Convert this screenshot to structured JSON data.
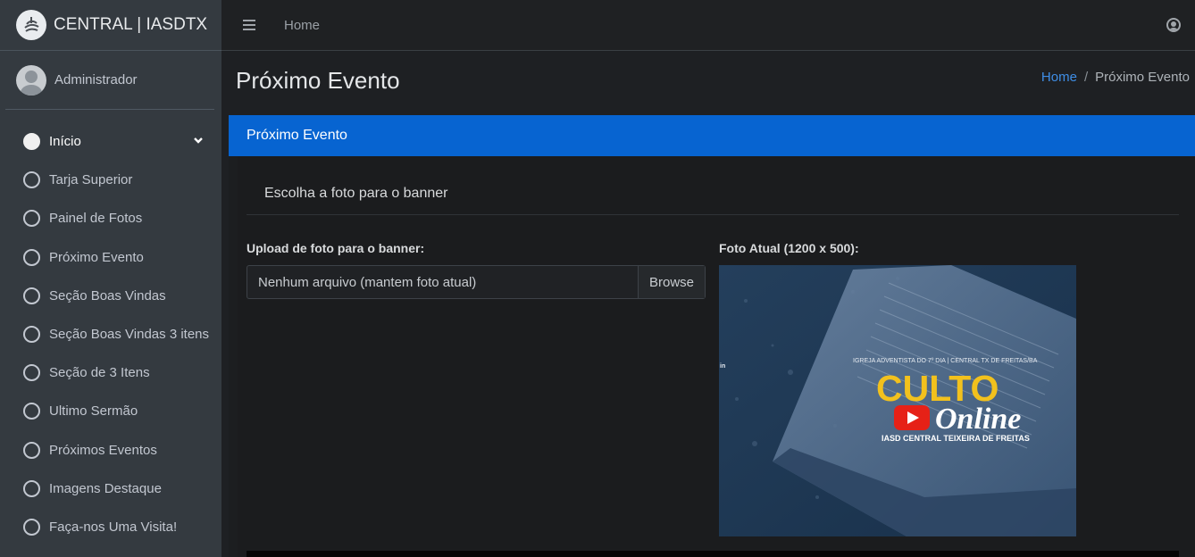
{
  "brand": {
    "title": "CENTRAL | IASDTX",
    "logo_icon": "church-logo-icon"
  },
  "user": {
    "name": "Administrador",
    "avatar_icon": "avatar-icon"
  },
  "sidebar": {
    "items": [
      {
        "label": "Início",
        "active": true
      },
      {
        "label": "Tarja Superior"
      },
      {
        "label": "Painel de Fotos"
      },
      {
        "label": "Próximo Evento"
      },
      {
        "label": "Seção Boas Vindas"
      },
      {
        "label": "Seção Boas Vindas 3 itens"
      },
      {
        "label": "Seção de 3 Itens"
      },
      {
        "label": "Ultimo Sermão"
      },
      {
        "label": "Próximos Eventos"
      },
      {
        "label": "Imagens Destaque"
      },
      {
        "label": "Faça-nos Uma Visita!"
      }
    ]
  },
  "topbar": {
    "home_label": "Home"
  },
  "header": {
    "title": "Próximo Evento",
    "breadcrumb": {
      "home": "Home",
      "separator": "/",
      "current": "Próximo Evento"
    }
  },
  "card": {
    "title": "Próximo Evento",
    "subtitle": "Escolha a foto para o banner",
    "upload_label": "Upload de foto para o banner:",
    "file_placeholder": "Nenhum arquivo (mantem foto atual)",
    "browse_label": "Browse",
    "current_photo_label": "Foto Atual (1200 x 500):",
    "banner": {
      "church_line": "IGREJA ADVENTISTA DO 7º DIA | CENTRAL TX DE FREITAS/BA",
      "headline": "CULTO",
      "script": "Online",
      "footer": "IASD CENTRAL TEIXEIRA DE FREITAS",
      "side_mark": "in"
    }
  },
  "colors": {
    "accent": "#0764d1",
    "link": "#3f8ee6",
    "sidebar_bg": "#343a40",
    "banner_yellow": "#f2c11d",
    "youtube_red": "#e62117"
  }
}
